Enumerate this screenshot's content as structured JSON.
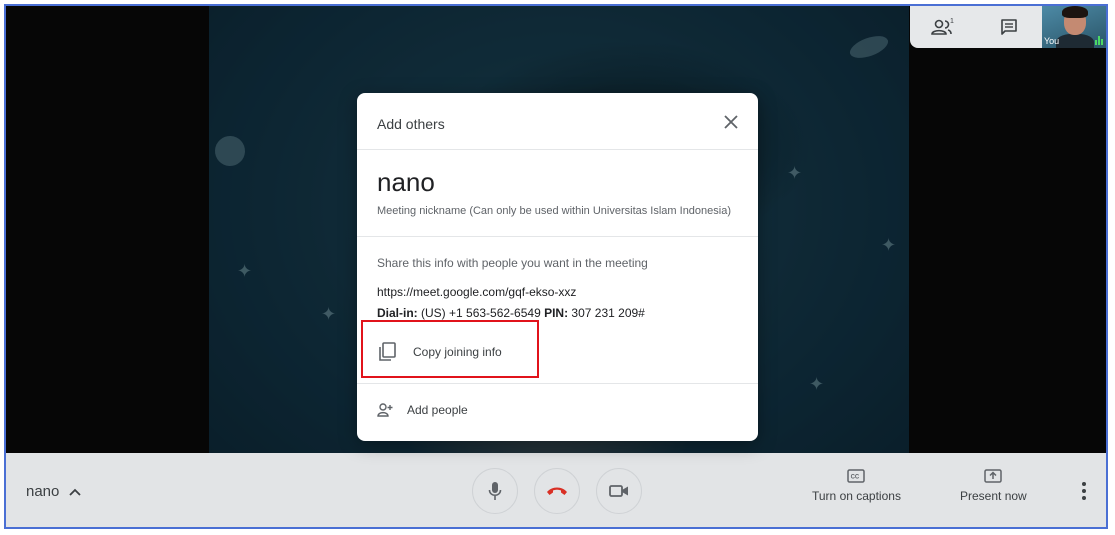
{
  "dialog": {
    "title": "Add others",
    "close_icon": "close-icon",
    "meeting_nickname": "nano",
    "nickname_note": "Meeting nickname (Can only be used within Universitas Islam Indonesia)",
    "share_text": "Share this info with people you want in the meeting",
    "meeting_link": "https://meet.google.com/gqf-ekso-xxz",
    "dialin_label": "Dial-in:",
    "dialin_number": " (US) +1 563-562-6549 ",
    "pin_label": "PIN:",
    "pin_value": " 307 231 209#",
    "copy_label": "Copy joining info",
    "add_people_label": "Add people"
  },
  "top_controls": {
    "participants_count": "1",
    "self_label": "You"
  },
  "bottom_bar": {
    "meeting_name": "nano",
    "captions_label": "Turn on captions",
    "present_label": "Present now"
  },
  "colors": {
    "highlight": "#e1131b",
    "end_call": "#d93025",
    "frame_border": "#4a6fd4"
  }
}
